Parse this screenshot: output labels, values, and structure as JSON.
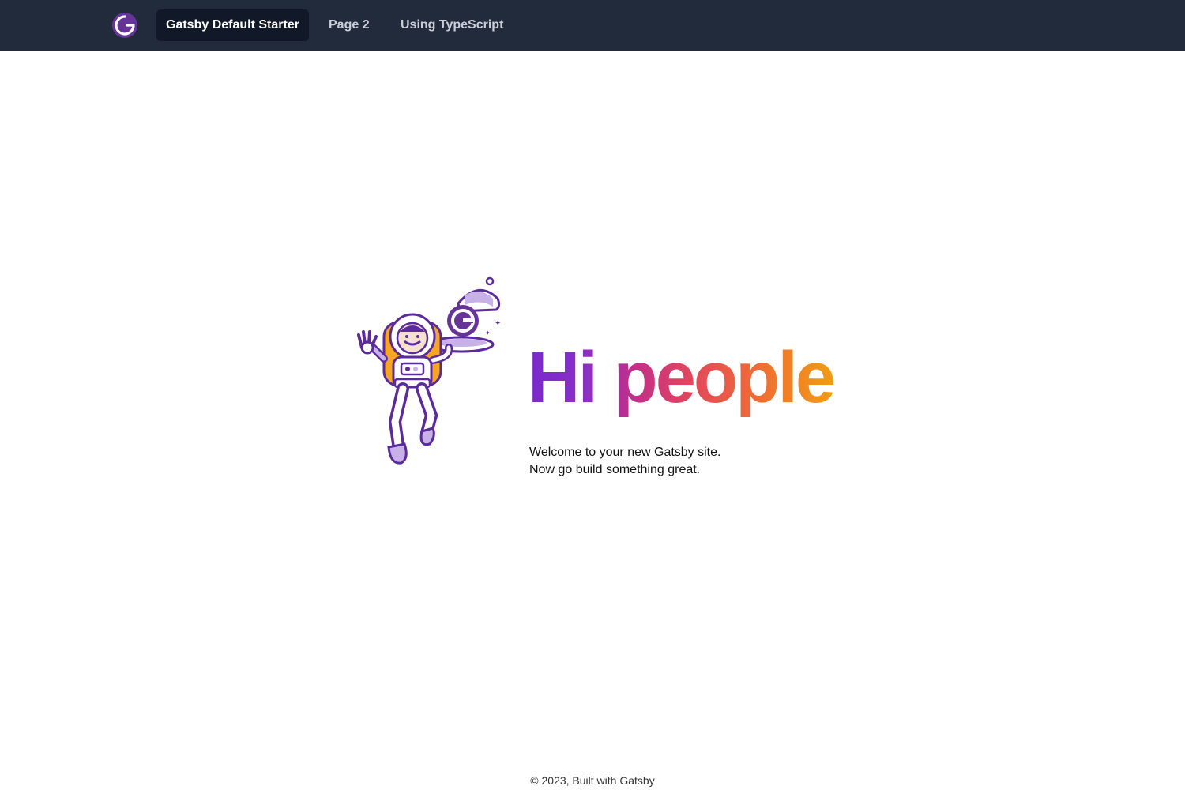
{
  "header": {
    "logo_icon": "gatsby-logo-icon",
    "nav": [
      {
        "label": "Gatsby Default Starter",
        "active": true
      },
      {
        "label": "Page 2",
        "active": false
      },
      {
        "label": "Using TypeScript",
        "active": false
      }
    ]
  },
  "hero": {
    "illustration": "astronaut-waiter-illustration",
    "title": "Hi people",
    "lines": [
      "Welcome to your new Gatsby site.",
      "Now go build something great."
    ]
  },
  "footer": {
    "text": "© 2023, Built with Gatsby"
  },
  "colors": {
    "header_bg": "#222b3b",
    "active_tab_bg": "#111827",
    "brand_purple": "#663399",
    "gradient": [
      "#7a28cc",
      "#c02e8c",
      "#e0455f",
      "#f06a35",
      "#f39b14"
    ]
  }
}
